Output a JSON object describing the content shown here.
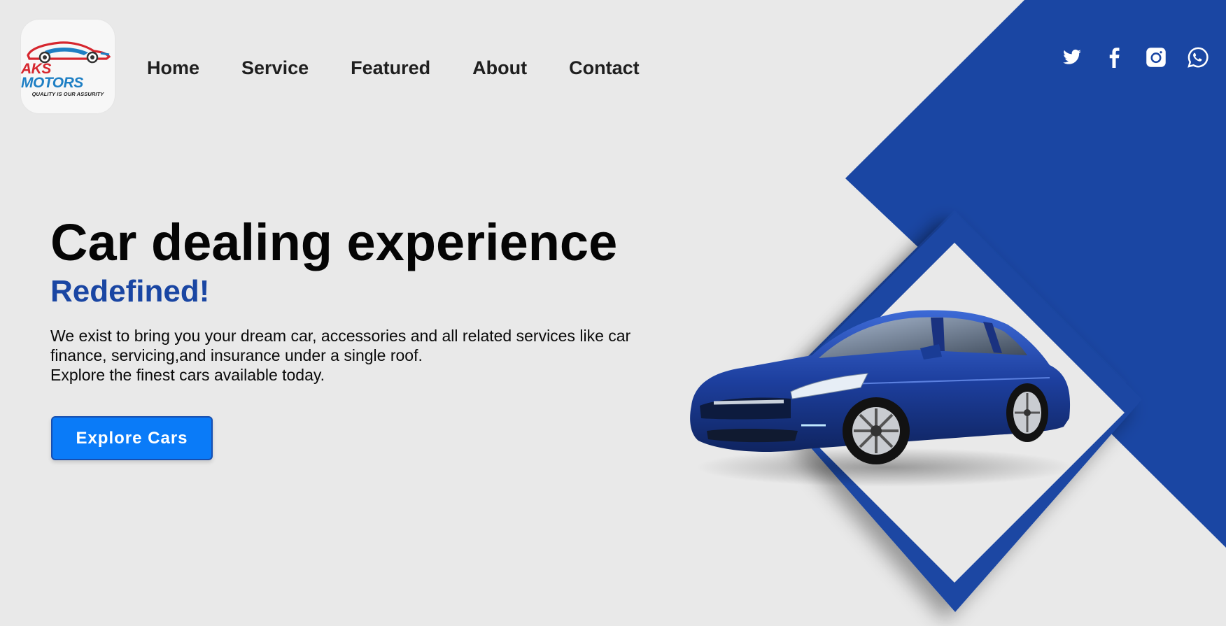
{
  "brand": {
    "name_part1": "AKS",
    "name_part2": "MOTORS",
    "tagline": "QUALITY IS OUR ASSURITY"
  },
  "nav": {
    "items": [
      {
        "label": "Home"
      },
      {
        "label": "Service"
      },
      {
        "label": "Featured"
      },
      {
        "label": "About"
      },
      {
        "label": "Contact"
      }
    ]
  },
  "social": {
    "icons": [
      "twitter-icon",
      "facebook-icon",
      "instagram-icon",
      "whatsapp-icon"
    ]
  },
  "hero": {
    "title": "Car dealing experience",
    "subtitle": "Redefined!",
    "description_line1": "We exist to bring you your dream car, accessories and all related services like car",
    "description_line2": "finance, servicing,and insurance under a single roof.",
    "description_line3": "Explore the finest cars available today.",
    "cta_label": "Explore Cars"
  },
  "colors": {
    "background": "#e9e9e9",
    "accent_blue": "#1a46a3",
    "button_blue": "#0a7bf8",
    "logo_red": "#d6262e",
    "logo_blue": "#1e7fc4"
  }
}
